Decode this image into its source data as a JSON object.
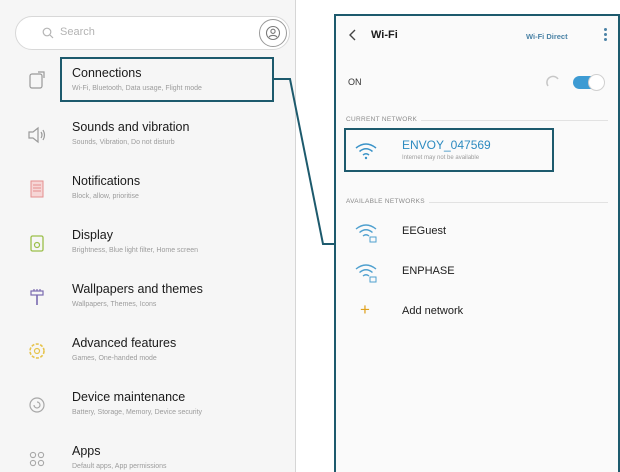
{
  "settings": {
    "search_placeholder": "Search",
    "items": [
      {
        "title": "Connections",
        "subtitle": "Wi-Fi, Bluetooth, Data usage, Flight mode",
        "icon": "connections-icon"
      },
      {
        "title": "Sounds and vibration",
        "subtitle": "Sounds, Vibration, Do not disturb",
        "icon": "speaker-icon"
      },
      {
        "title": "Notifications",
        "subtitle": "Block, allow, prioritise",
        "icon": "notifications-icon"
      },
      {
        "title": "Display",
        "subtitle": "Brightness, Blue light filter, Home screen",
        "icon": "display-icon"
      },
      {
        "title": "Wallpapers and themes",
        "subtitle": "Wallpapers, Themes, Icons",
        "icon": "brush-icon"
      },
      {
        "title": "Advanced features",
        "subtitle": "Games, One-handed mode",
        "icon": "gear-icon"
      },
      {
        "title": "Device maintenance",
        "subtitle": "Battery, Storage, Memory, Device security",
        "icon": "maintenance-icon"
      },
      {
        "title": "Apps",
        "subtitle": "Default apps, App permissions",
        "icon": "apps-icon"
      }
    ]
  },
  "wifi": {
    "title": "Wi-Fi",
    "direct_label": "Wi-Fi Direct",
    "status": "ON",
    "toggle_on": true,
    "current_header": "CURRENT NETWORK",
    "current": {
      "name": "ENVOY_047569",
      "status": "Internet may not be available"
    },
    "available_header": "AVAILABLE NETWORKS",
    "networks": [
      {
        "name": "EEGuest",
        "icon": "wifi-locked-icon"
      },
      {
        "name": "ENPHASE",
        "icon": "wifi-locked-icon"
      }
    ],
    "add_label": "Add network"
  },
  "colors": {
    "highlight": "#1d5a6d",
    "accent_blue": "#2d8bc0",
    "toggle": "#3d9bd3",
    "add_plus": "#e0a11d"
  }
}
